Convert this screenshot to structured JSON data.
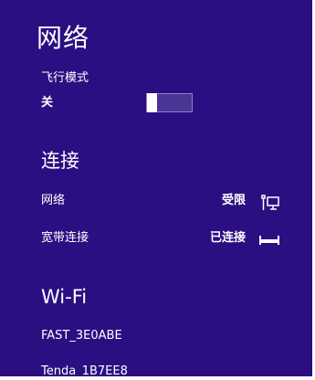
{
  "pane": {
    "title": "网络"
  },
  "airplane_mode": {
    "label": "飞行模式",
    "state": "关",
    "is_on": false
  },
  "connections": {
    "title": "连接",
    "items": [
      {
        "name": "网络",
        "status": "受限",
        "icon": "network-monitor-icon"
      },
      {
        "name": "宽带连接",
        "status": "已连接",
        "icon": "broadband-connection-icon"
      }
    ]
  },
  "wifi": {
    "title": "Wi-Fi",
    "networks": [
      "FAST_3E0ABE",
      "Tenda_1B7EE8"
    ]
  },
  "colors": {
    "panel_background": "#2b0f82",
    "text": "#ffffff",
    "toggle_track": "#4a3494",
    "toggle_border": "#8d7fc3"
  }
}
